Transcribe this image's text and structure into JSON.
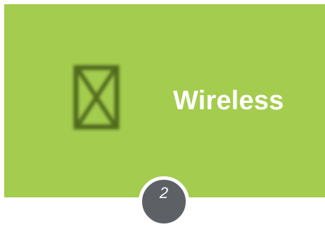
{
  "tile": {
    "title": "Wireless",
    "background_color": "#a4cc4e",
    "icon": "wireless-placeholder-icon",
    "icon_color": "#4f6a1e"
  },
  "step_badge": {
    "number": "2",
    "color": "#5d6166"
  }
}
